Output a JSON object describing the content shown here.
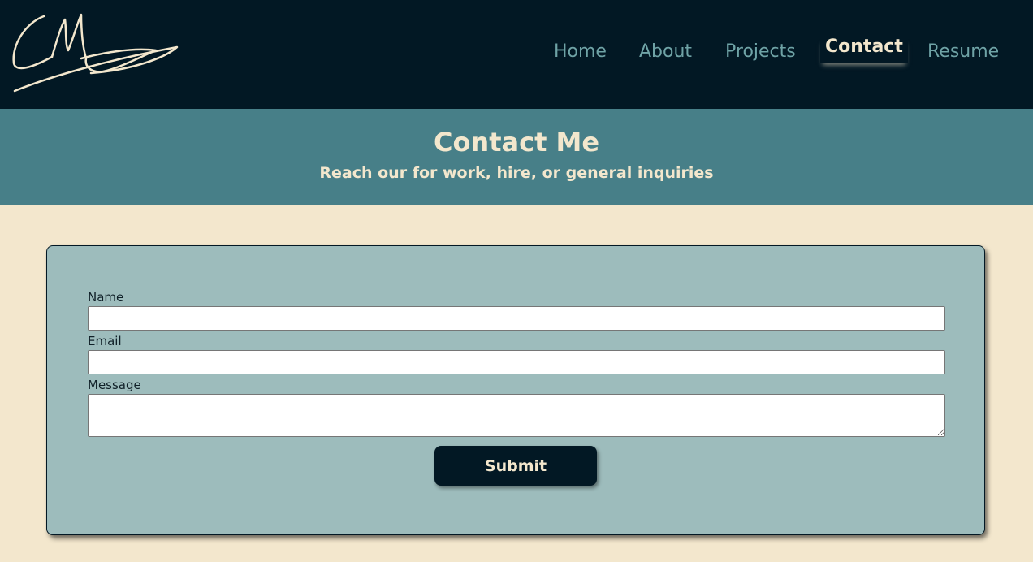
{
  "navbar": {
    "logo_text": "CM",
    "links": [
      {
        "label": "Home"
      },
      {
        "label": "About"
      },
      {
        "label": "Projects"
      },
      {
        "label": "Contact",
        "active": true
      },
      {
        "label": "Resume"
      }
    ]
  },
  "hero": {
    "title": "Contact Me",
    "subtitle": "Reach our for work, hire, or general inquiries"
  },
  "form": {
    "name_label": "Name",
    "name_value": "",
    "email_label": "Email",
    "email_value": "",
    "message_label": "Message",
    "message_value": "",
    "submit_label": "Submit"
  },
  "colors": {
    "navbar_bg": "#021824",
    "hero_bg": "#477f88",
    "page_bg": "#f3e7cd",
    "card_bg": "#9dbcbc",
    "nav_link": "#6fa3a6",
    "accent_text": "#f3e7cd"
  },
  "icons": {
    "logo": "signature-logo-icon"
  }
}
